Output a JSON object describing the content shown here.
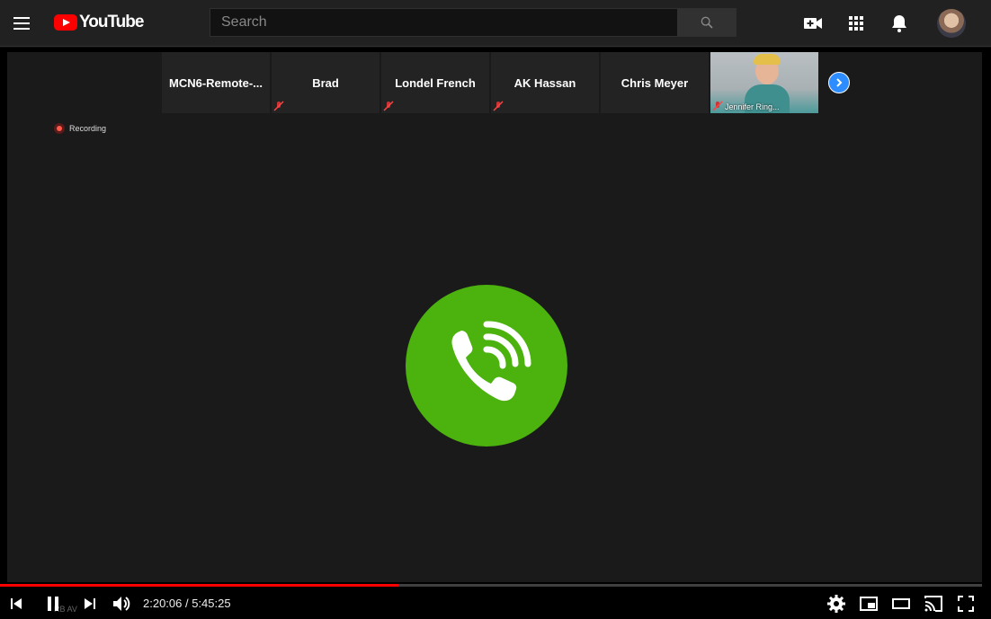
{
  "masthead": {
    "logo_text": "YouTube",
    "search_placeholder": "Search"
  },
  "meeting": {
    "participants": [
      {
        "name": "MCN6-Remote-...",
        "muted": false
      },
      {
        "name": "Brad",
        "muted": true
      },
      {
        "name": "Londel French",
        "muted": true
      },
      {
        "name": "AK Hassan",
        "muted": true
      },
      {
        "name": "Chris Meyer",
        "muted": false
      }
    ],
    "video_participant": "Jennifer Ring...",
    "recording_label": "Recording",
    "call_icon": "phone-ringing-icon",
    "call_icon_color": "#4bb20e",
    "watermark": "RB AV"
  },
  "player": {
    "current_time": "2:20:06",
    "separator": " / ",
    "duration": "5:45:25",
    "progress_fraction": 0.406,
    "progress_color": "#ff0000"
  }
}
